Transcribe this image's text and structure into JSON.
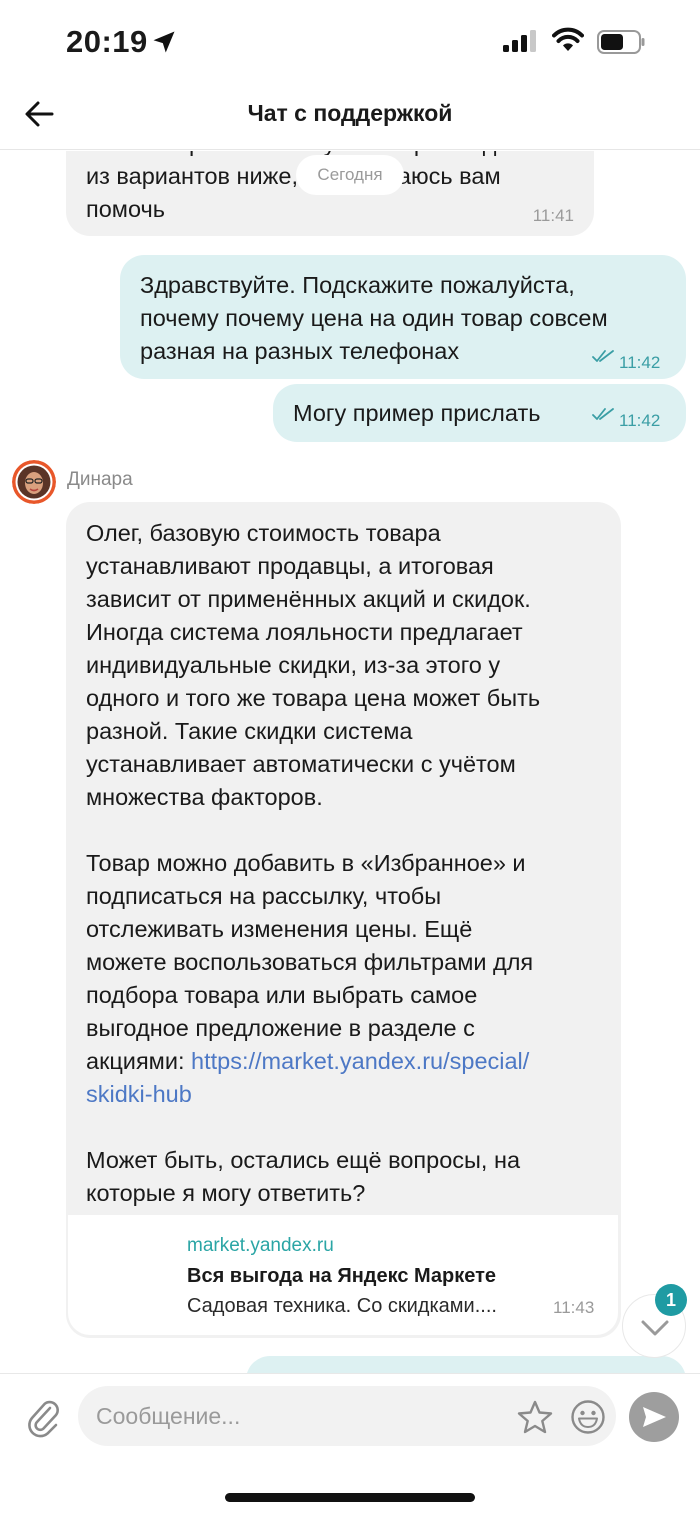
{
  "status_bar": {
    "time": "20:19"
  },
  "header": {
    "title": "Чат с поддержкой"
  },
  "chat": {
    "date_separator": "Сегодня",
    "messages": [
      {
        "direction": "in",
        "lines": [
          "У вас вопрос по заказу? Выберите один",
          "из вариантов ниже, я постараюсь вам",
          "помочь"
        ],
        "time": "11:41"
      },
      {
        "direction": "out",
        "lines": [
          "Здравствуйте. Подскажите пожалуйста,",
          "почему почему цена на один товар совсем",
          "разная на разных телефонах"
        ],
        "time": "11:42"
      },
      {
        "direction": "out",
        "lines": [
          "Могу пример прислать"
        ],
        "time": "11:42"
      },
      {
        "direction": "in",
        "sender": "Динара",
        "paragraphs": [
          [
            "Олег, базовую стоимость товара",
            "устанавливают продавцы, а итоговая",
            "зависит от применённых акций и скидок.",
            "Иногда система лояльности предлагает",
            "индивидуальные скидки, из-за этого у",
            "одного и того же товара цена может быть",
            "разной. Такие скидки система",
            "устанавливает автоматически с учётом",
            "множества факторов."
          ],
          [
            "Товар можно добавить в «Избранное» и",
            "подписаться на рассылку, чтобы",
            "отслеживать изменения цены. Ещё",
            "можете воспользоваться фильтрами для",
            "подбора товара или выбрать самое",
            "выгодное предложение в разделе с"
          ],
          [
            "Может быть, остались ещё вопросы, на",
            "которые я могу ответить?"
          ]
        ],
        "link_prefix": "акциями: ",
        "link_line1": "https://market.yandex.ru/special/",
        "link_line2": "skidki-hub",
        "preview": {
          "domain": "market.yandex.ru",
          "title": "Вся выгода на Яндекс Маркете",
          "description": "Садовая техника. Со скидками...."
        },
        "time": "11:43"
      }
    ],
    "unread_count": "1"
  },
  "input": {
    "placeholder": "Сообщение..."
  },
  "colors": {
    "accent": "#1f9ba3",
    "outgoing_bubble": "#ddf1f2",
    "incoming_bubble": "#f1f1f1",
    "link": "#4d78c5"
  }
}
